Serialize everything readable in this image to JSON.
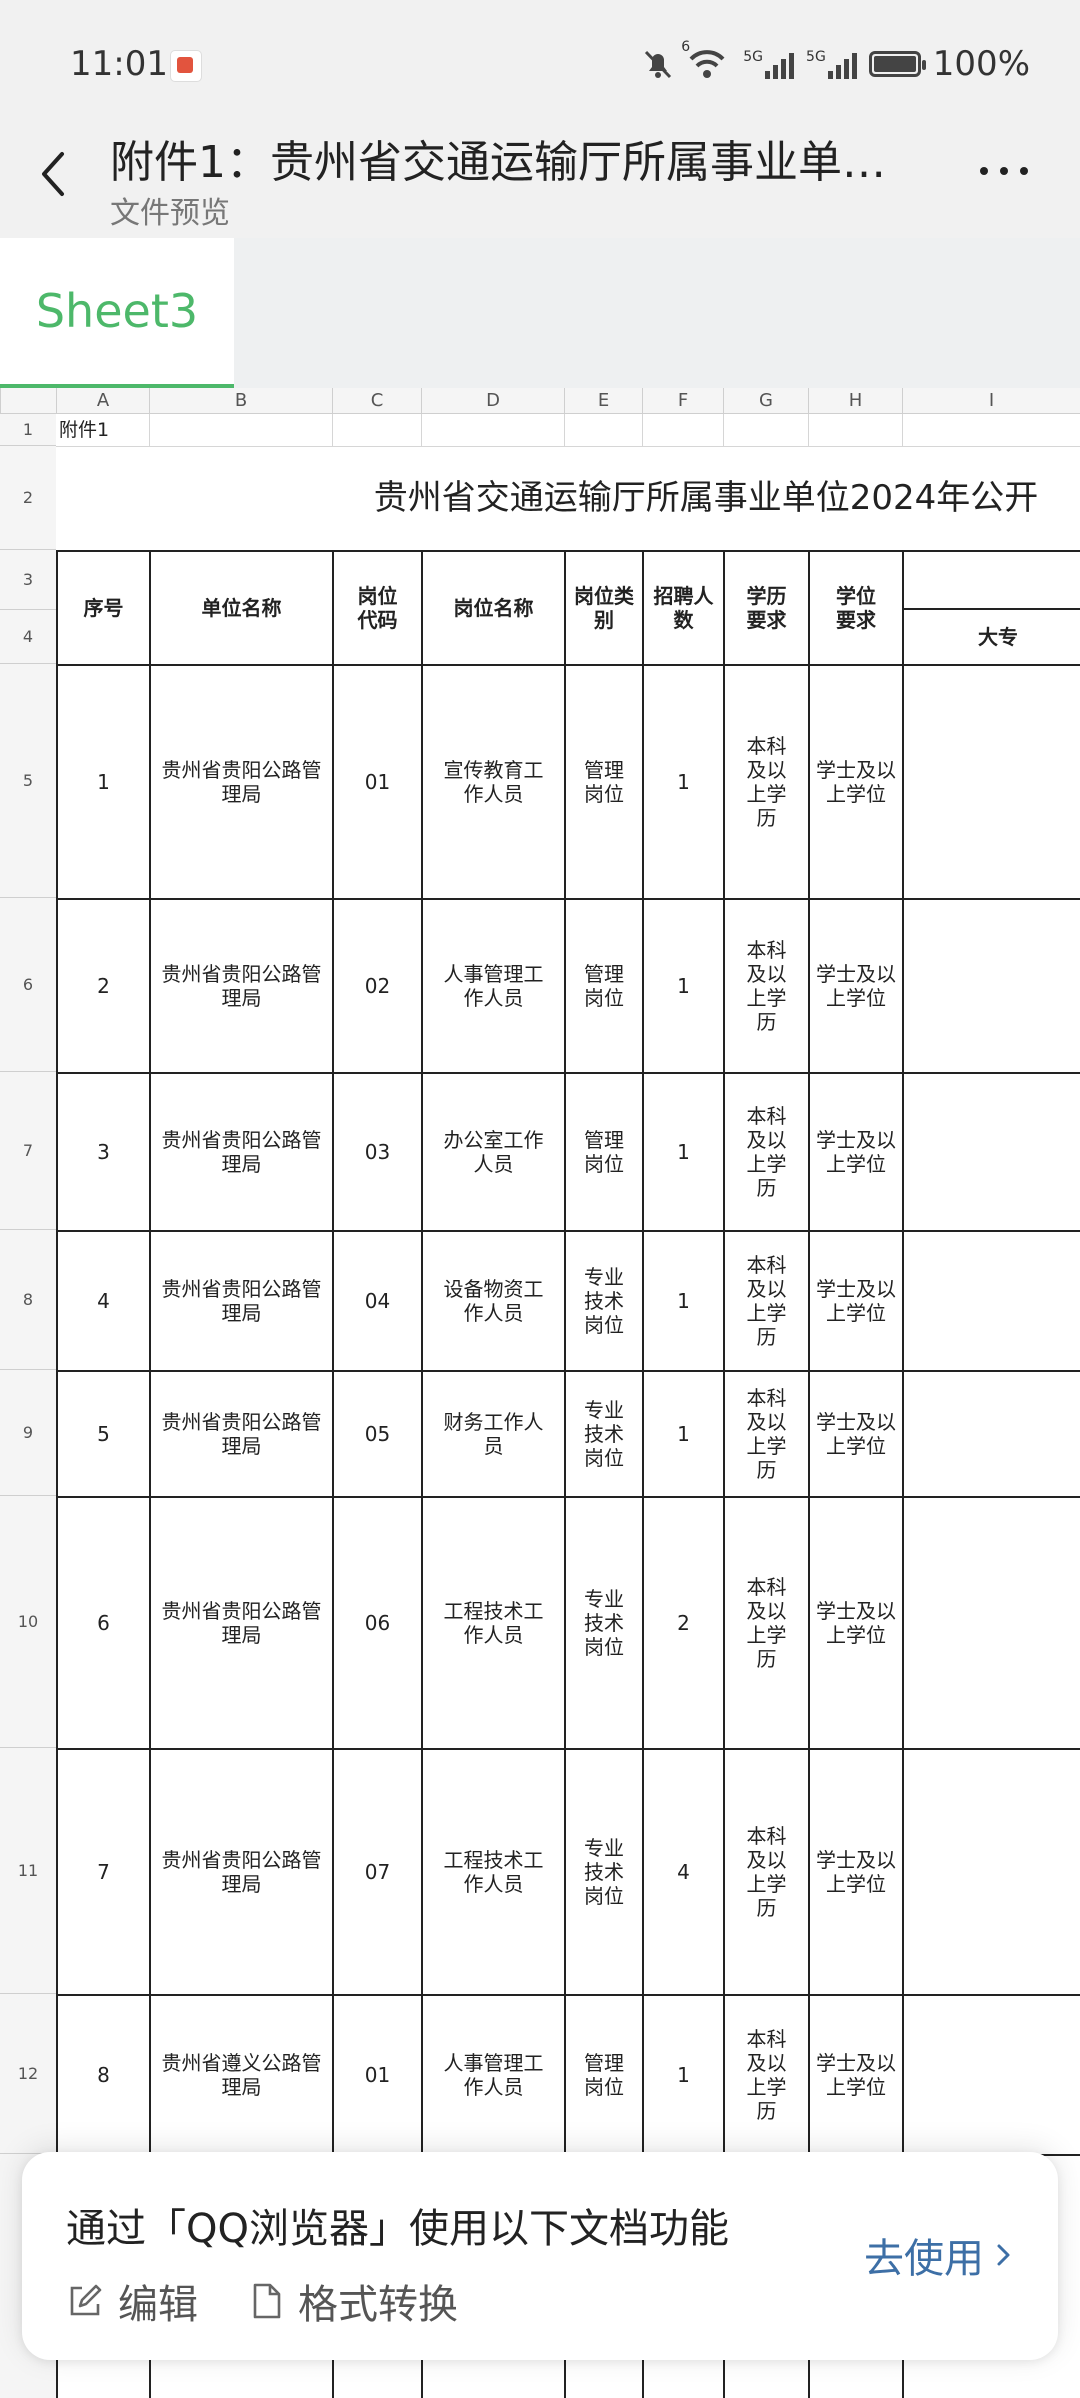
{
  "status_bar": {
    "time": "11:01",
    "signal1": "5G",
    "wifi_badge": "6",
    "signal2": "5G",
    "battery": "100%"
  },
  "header": {
    "title": "附件1：贵州省交通运输厅所属事业单…",
    "subtitle": "文件预览"
  },
  "sheet_tab": {
    "label": "Sheet3"
  },
  "column_headers": [
    "A",
    "B",
    "C",
    "D",
    "E",
    "F",
    "G",
    "H",
    "I"
  ],
  "row_numbers": [
    "1",
    "2",
    "3",
    "4",
    "5",
    "6",
    "7",
    "8",
    "9",
    "10",
    "11",
    "12"
  ],
  "cell_a1": "附件1",
  "sheet_title": "贵州省交通运输厅所属事业单位2024年公开",
  "table_headers": {
    "seq": "序号",
    "unit": "单位名称",
    "code": "岗位代码",
    "post": "岗位名称",
    "category": "岗位类别",
    "count": "招聘人数",
    "education": "学历要求",
    "degree": "学位要求",
    "major_college": "大专"
  },
  "rows": [
    {
      "seq": "1",
      "unit": "贵州省贵阳公路管理局",
      "code": "01",
      "post": "宣传教育工作人员",
      "category": "管理岗位",
      "count": "1",
      "education": "本科及以上学历",
      "degree": "学士及以上学位"
    },
    {
      "seq": "2",
      "unit": "贵州省贵阳公路管理局",
      "code": "02",
      "post": "人事管理工作人员",
      "category": "管理岗位",
      "count": "1",
      "education": "本科及以上学历",
      "degree": "学士及以上学位"
    },
    {
      "seq": "3",
      "unit": "贵州省贵阳公路管理局",
      "code": "03",
      "post": "办公室工作人员",
      "category": "管理岗位",
      "count": "1",
      "education": "本科及以上学历",
      "degree": "学士及以上学位"
    },
    {
      "seq": "4",
      "unit": "贵州省贵阳公路管理局",
      "code": "04",
      "post": "设备物资工作人员",
      "category": "专业技术岗位",
      "count": "1",
      "education": "本科及以上学历",
      "degree": "学士及以上学位"
    },
    {
      "seq": "5",
      "unit": "贵州省贵阳公路管理局",
      "code": "05",
      "post": "财务工作人员",
      "category": "专业技术岗位",
      "count": "1",
      "education": "本科及以上学历",
      "degree": "学士及以上学位"
    },
    {
      "seq": "6",
      "unit": "贵州省贵阳公路管理局",
      "code": "06",
      "post": "工程技术工作人员",
      "category": "专业技术岗位",
      "count": "2",
      "education": "本科及以上学历",
      "degree": "学士及以上学位"
    },
    {
      "seq": "7",
      "unit": "贵州省贵阳公路管理局",
      "code": "07",
      "post": "工程技术工作人员",
      "category": "专业技术岗位",
      "count": "4",
      "education": "本科及以上学历",
      "degree": "学士及以上学位"
    },
    {
      "seq": "8",
      "unit": "贵州省遵义公路管理局",
      "code": "01",
      "post": "人事管理工作人员",
      "category": "管理岗位",
      "count": "1",
      "education": "本科及以上学历",
      "degree": "学士及以上学位"
    }
  ],
  "popup": {
    "message": "通过「QQ浏览器」使用以下文档功能",
    "edit_label": "编辑",
    "convert_label": "格式转换",
    "action_label": "去使用"
  },
  "colors": {
    "accent_green": "#4db86a",
    "link_blue": "#3d6fa6"
  }
}
